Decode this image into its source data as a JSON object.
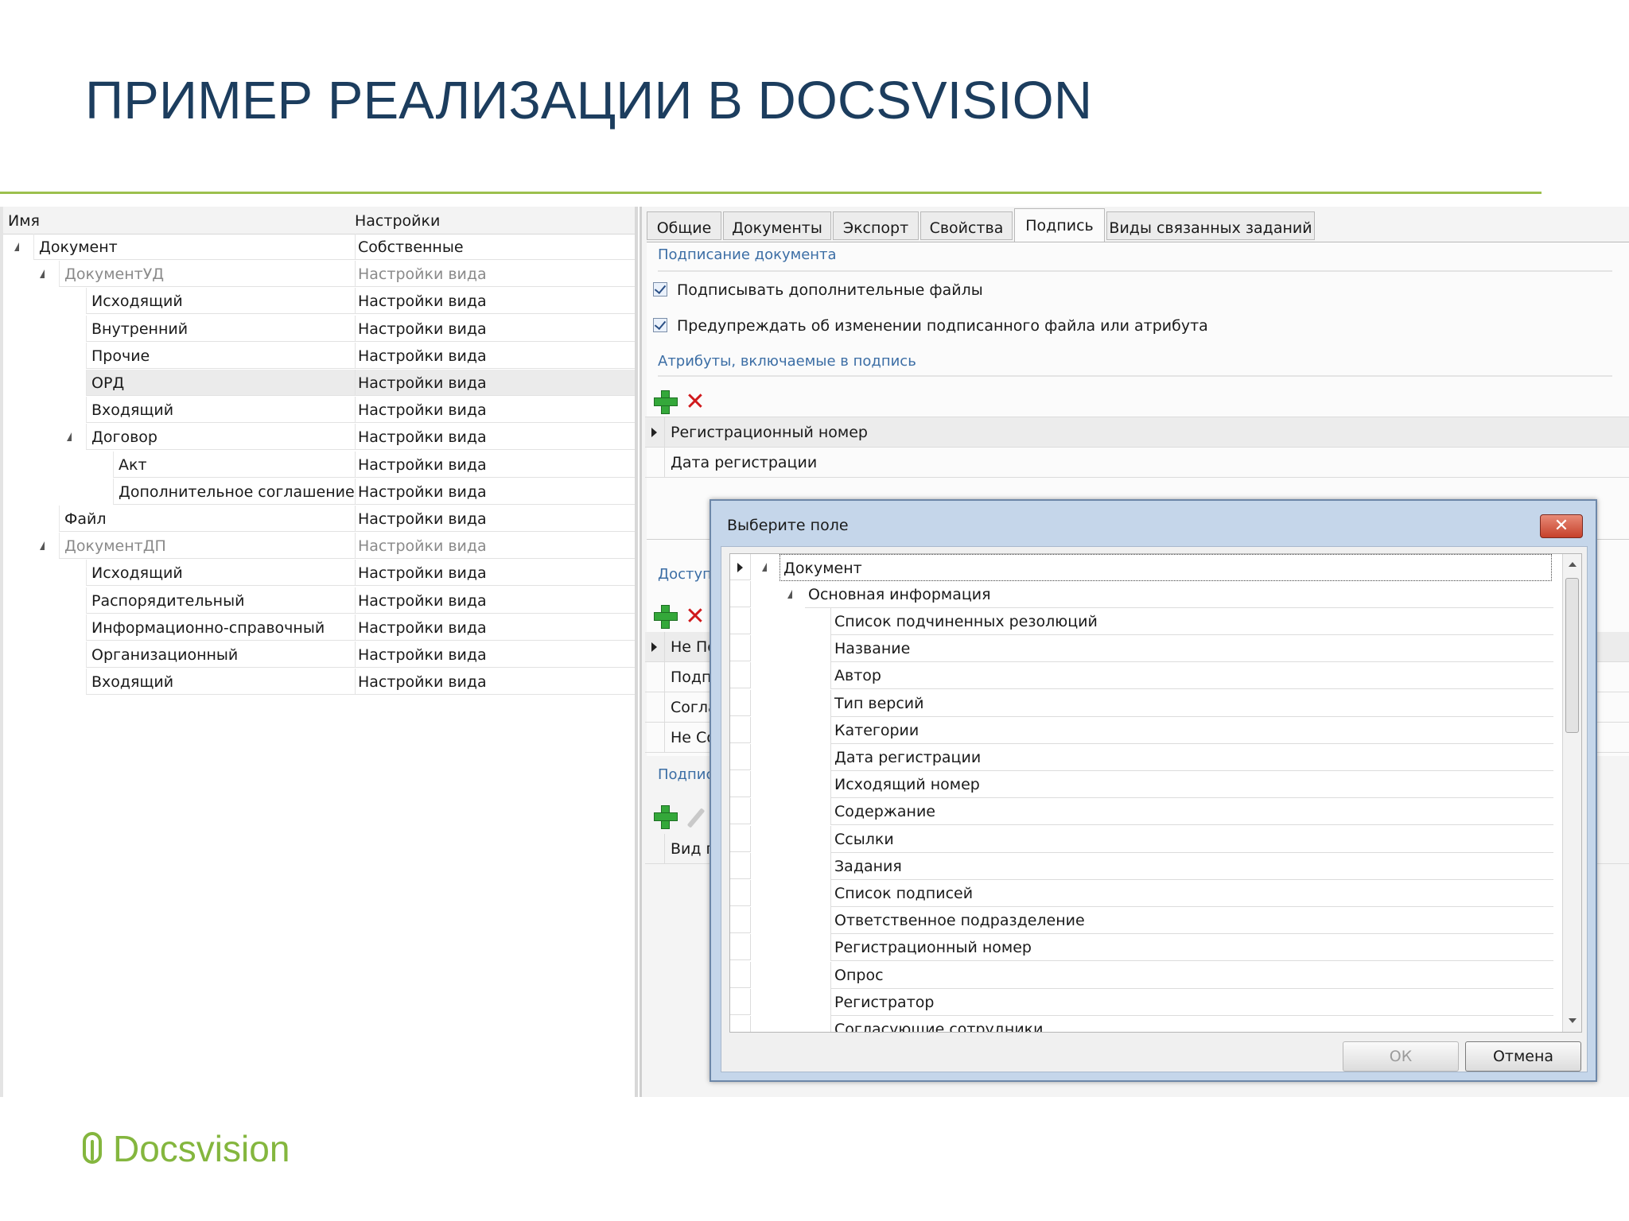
{
  "slide": {
    "title": "ПРИМЕР РЕАЛИЗАЦИИ В DOCSVISION"
  },
  "tree": {
    "headers": {
      "name": "Имя",
      "settings": "Настройки"
    },
    "rows": [
      {
        "name": "Документ",
        "settings": "Собственные"
      },
      {
        "name": "ДокументУД",
        "settings": "Настройки вида"
      },
      {
        "name": "Исходящий",
        "settings": "Настройки вида"
      },
      {
        "name": "Внутренний",
        "settings": "Настройки вида"
      },
      {
        "name": "Прочие",
        "settings": "Настройки вида"
      },
      {
        "name": "ОРД",
        "settings": "Настройки вида"
      },
      {
        "name": "Входящий",
        "settings": "Настройки вида"
      },
      {
        "name": "Договор",
        "settings": "Настройки вида"
      },
      {
        "name": "Акт",
        "settings": "Настройки вида"
      },
      {
        "name": "Дополнительное соглашение",
        "settings": "Настройки вида"
      },
      {
        "name": "Файл",
        "settings": "Настройки вида"
      },
      {
        "name": "ДокументДП",
        "settings": "Настройки вида"
      },
      {
        "name": "Исходящий",
        "settings": "Настройки вида"
      },
      {
        "name": "Распорядительный",
        "settings": "Настройки вида"
      },
      {
        "name": "Информационно-справочный",
        "settings": "Настройки вида"
      },
      {
        "name": "Организационный",
        "settings": "Настройки вида"
      },
      {
        "name": "Входящий",
        "settings": "Настройки вида"
      }
    ]
  },
  "tabs": [
    "Общие",
    "Документы",
    "Экспорт",
    "Свойства",
    "Подпись",
    "Виды связанных заданий"
  ],
  "signing": {
    "section_title": "Подписание документа",
    "checkbox1": "Подписывать дополнительные файлы",
    "checkbox2": "Предупреждать об изменении подписанного файла или атрибута",
    "attributes_title": "Атрибуты, включаемые в подпись",
    "attributes": [
      "Регистрационный номер",
      "Дата регистрации"
    ],
    "access_title": "Доступ",
    "access_rows": [
      "Не По",
      "Подп",
      "Согла",
      "Не Со"
    ],
    "sign_title": "Подпис",
    "sign_rows": [
      "Вид п"
    ]
  },
  "dialog": {
    "title": "Выберите поле",
    "close_label": "✕",
    "root": "Документ",
    "group": "Основная информация",
    "fields": [
      "Список подчиненных резолюций",
      "Название",
      "Автор",
      "Тип версий",
      "Категории",
      "Дата регистрации",
      "Исходящий номер",
      "Содержание",
      "Ссылки",
      "Задания",
      "Список подписей",
      "Ответственное подразделение",
      "Регистрационный номер",
      "Опрос",
      "Регистратор",
      "Согласующие сотрудники"
    ],
    "ok_label": "ОК",
    "cancel_label": "Отмена"
  },
  "logo": {
    "text": "Docsvision"
  },
  "colors": {
    "title": "#1c3d5e",
    "accent_green": "#84b63e",
    "section_blue": "#3c6ea5"
  }
}
